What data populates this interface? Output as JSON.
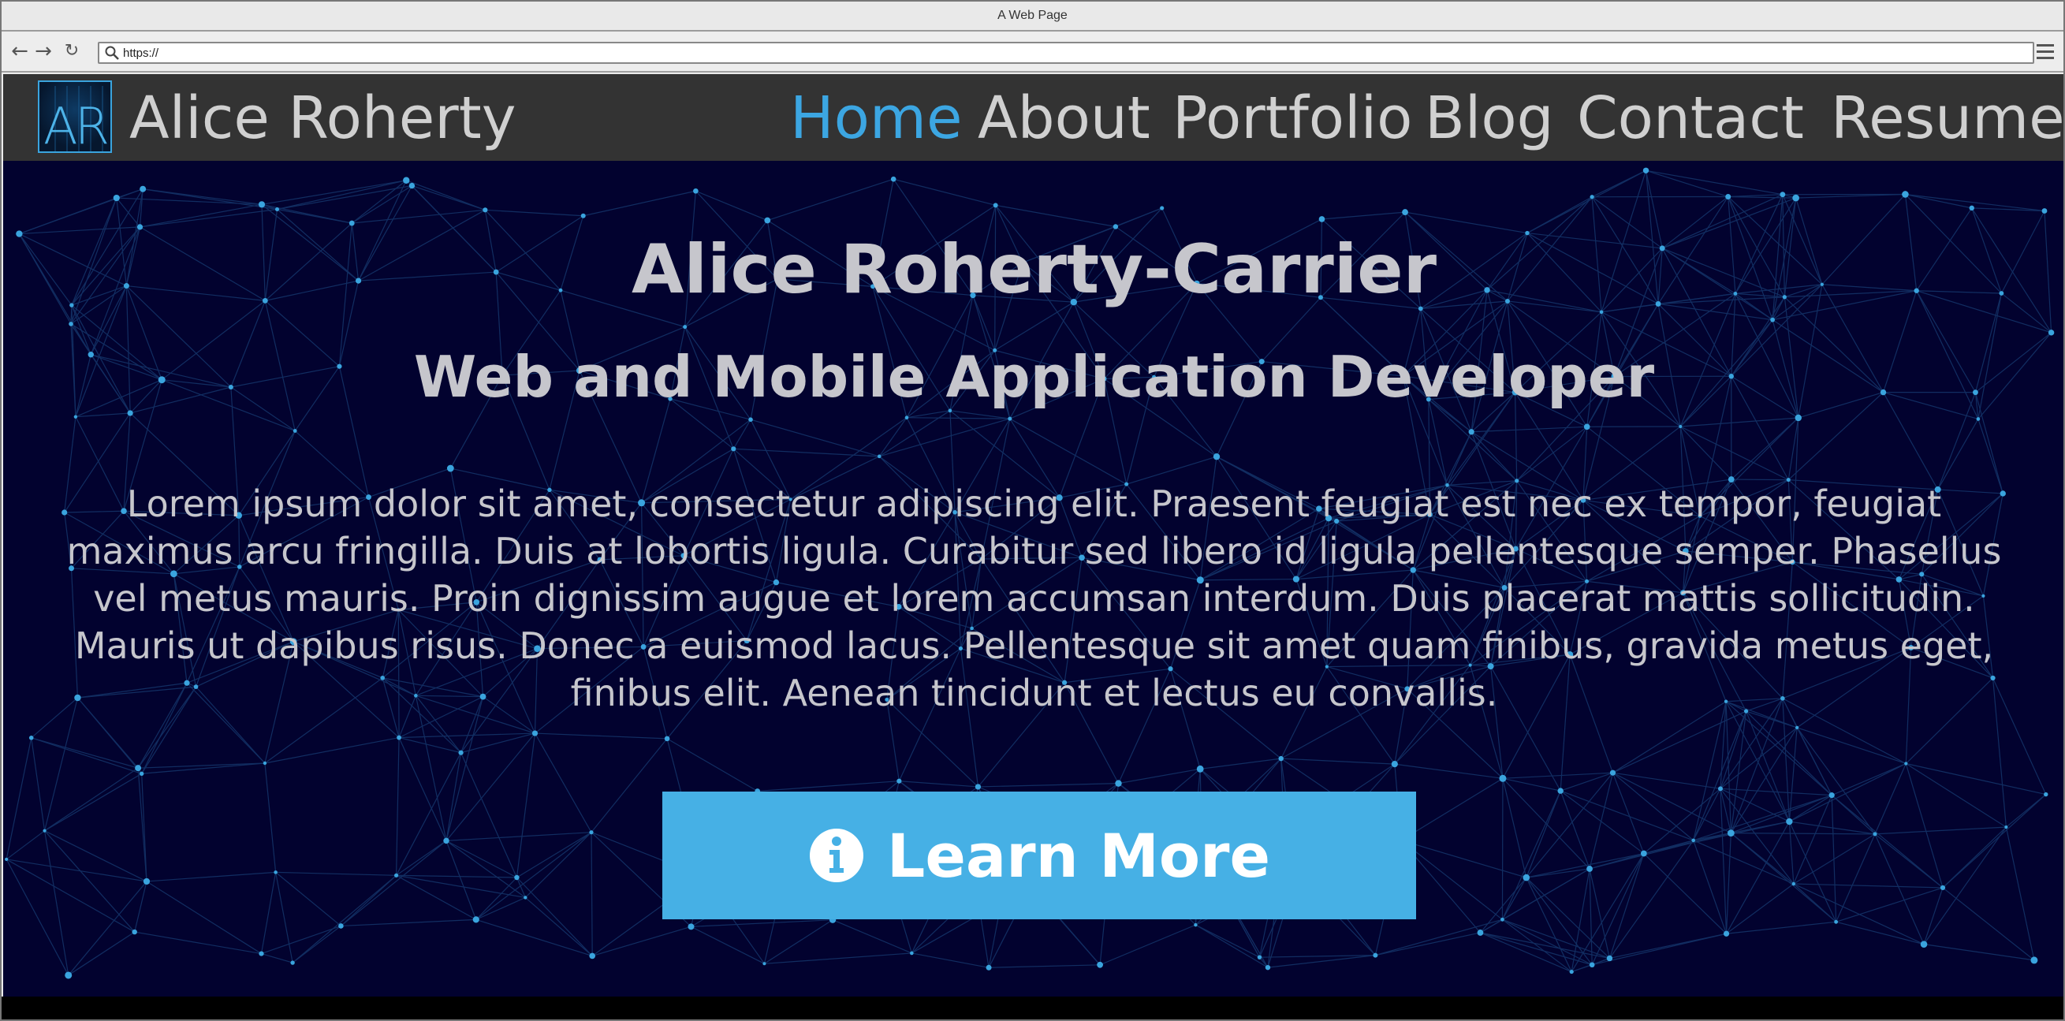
{
  "browser": {
    "window_title": "A Web Page",
    "url": "https://",
    "icons": {
      "back": "back-arrow-icon",
      "forward": "forward-arrow-icon",
      "reload": "reload-icon",
      "search": "search-icon",
      "menu": "hamburger-menu-icon"
    }
  },
  "site": {
    "logo_text": "AR",
    "brand": "Alice Roherty",
    "nav": [
      {
        "label": "Home",
        "active": true
      },
      {
        "label": "About",
        "active": false
      },
      {
        "label": "Portfolio",
        "active": false
      },
      {
        "label": "Blog",
        "active": false
      },
      {
        "label": "Contact",
        "active": false
      },
      {
        "label": "Resume",
        "active": false
      }
    ]
  },
  "hero": {
    "title": "Alice Roherty-Carrier",
    "subtitle": "Web and Mobile Application Developer",
    "body": "Lorem ipsum dolor sit amet, consectetur adipiscing elit. Praesent feugiat est nec ex tempor, feugiat maximus arcu fringilla. Duis at lobortis ligula. Curabitur sed libero id ligula pellentesque semper. Phasellus vel metus mauris. Proin dignissim augue et lorem accumsan interdum. Duis placerat mattis sollicitudin. Mauris ut dapibus risus. Donec a euismod lacus. Pellentesque sit amet quam finibus, gravida metus eget, finibus elit. Aenean tincidunt et lectus eu convallis.",
    "cta_label": "Learn More",
    "cta_icon": "info-icon"
  },
  "colors": {
    "header_bg": "#333333",
    "nav_text": "#d0d0d0",
    "nav_active": "#3ca6e2",
    "hero_bg": "#02022f",
    "hero_text": "#c6c6cc",
    "cta_bg": "#46b0e5",
    "network": "#3aa4de"
  }
}
